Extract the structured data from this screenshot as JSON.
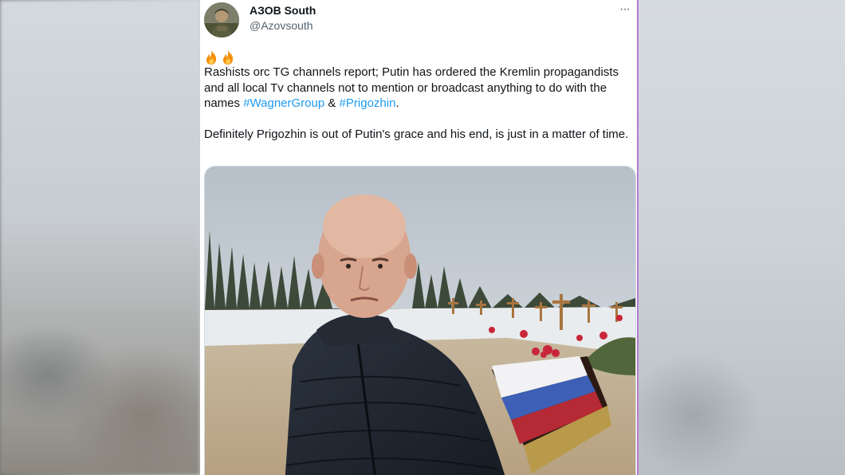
{
  "tweet": {
    "author": {
      "display_name": "АЗОВ South",
      "handle": "@Azovsouth",
      "avatar_icon": "avatar-soldier-photo"
    },
    "more_icon": "more-options-icon",
    "more_label": "···",
    "emoji_icons": [
      "fire-icon",
      "fire-icon"
    ],
    "text": {
      "p1_part1": "Rashists orc TG channels report; Putin has ordered the Kremlin propagandists and all local Tv channels not to mention or broadcast anything to do with the names ",
      "hashtag1": "#WagnerGroup",
      "amp": " & ",
      "hashtag2": "#Prigozhin",
      "period": ".",
      "p2": "Definitely Prigozhin is out of Putin's grace and his end, is just in a matter of time."
    },
    "media": {
      "description_icon": "photo-man-at-cemetery-grave"
    }
  },
  "colors": {
    "hashtag": "#1d9bf0",
    "text": "#0f1419",
    "secondary": "#536471"
  }
}
